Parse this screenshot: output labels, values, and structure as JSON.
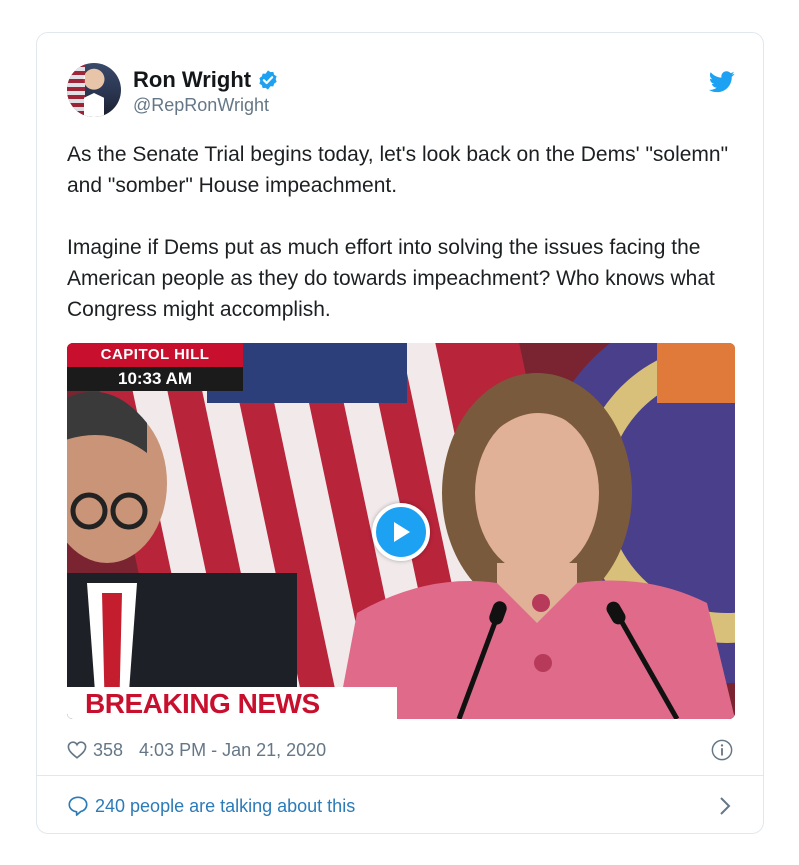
{
  "tweet": {
    "author": {
      "display_name": "Ron Wright",
      "handle": "@RepRonWright",
      "verified": true
    },
    "text": "As the Senate Trial begins today, let's look back on the Dems' \"solemn\" and \"somber\" House impeachment.\n\nImagine if Dems put as much effort into solving the issues facing the American people as they do towards impeachment? Who knows what Congress might accomplish.",
    "media": {
      "type": "video",
      "overlay": {
        "location": "CAPITOL HILL",
        "time": "10:33 AM",
        "banner": "BREAKING NEWS"
      }
    },
    "likes": "358",
    "timestamp": "4:03 PM - Jan 21, 2020",
    "talking_about": "240 people are talking about this"
  },
  "icons": {
    "verified": "verified-badge-icon",
    "brand": "twitter-bird-icon",
    "like": "heart-icon",
    "info": "info-icon",
    "reply": "speech-bubble-icon",
    "more": "chevron-right-icon",
    "play": "play-icon"
  },
  "colors": {
    "brand_blue": "#1da1f2",
    "link_blue": "#2b7bb9",
    "secondary_text": "#657786",
    "news_red": "#c8102e"
  }
}
